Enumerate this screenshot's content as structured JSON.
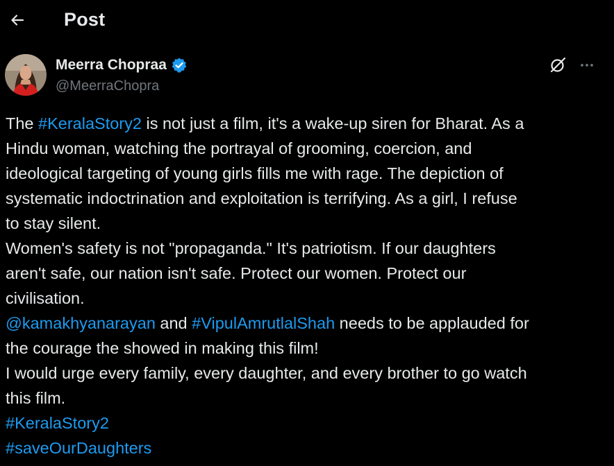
{
  "header": {
    "back_icon": "arrow-left-icon",
    "title": "Post"
  },
  "author": {
    "display_name": "Meerra Chopraa",
    "handle": "@MeerraChopra",
    "verified": true,
    "verified_color": "#1d9bf0",
    "avatar_icon": "profile-photo"
  },
  "actions": {
    "grok_icon": "grok-icon",
    "more_icon": "more-options-icon"
  },
  "tweet": {
    "p1_pre": "The ",
    "p1_tag": "#KeralaStory2",
    "p1_post": " is not just a film, it's a wake-up siren for Bharat. As a",
    "p2": "Hindu woman, watching the portrayal of grooming, coercion, and",
    "p3": "ideological targeting of young girls fills me with rage. The depiction of",
    "p4": "systematic indoctrination and exploitation is terrifying. As a girl, I refuse",
    "p5": "to stay silent.",
    "p6": "Women's safety is not \"propaganda.\" It's patriotism. If our daughters",
    "p7": "aren't safe, our nation isn't safe. Protect our women. Protect our",
    "p8": "civilisation.",
    "p9_mention": "@kamakhyanarayan",
    "p9_mid": " and ",
    "p9_tag": "#VipulAmrutlalShah",
    "p9_post": " needs to be applauded for",
    "p10": "the courage the showed in making this film!",
    "p11": "I would urge every family, every daughter, and every brother to go watch",
    "p12": "this film.",
    "tag_a": "#KeralaStory2",
    "tag_b": "#saveOurDaughters"
  },
  "colors": {
    "background": "#000000",
    "text": "#e7e9ea",
    "secondary": "#71767b",
    "link": "#1d9bf0"
  }
}
